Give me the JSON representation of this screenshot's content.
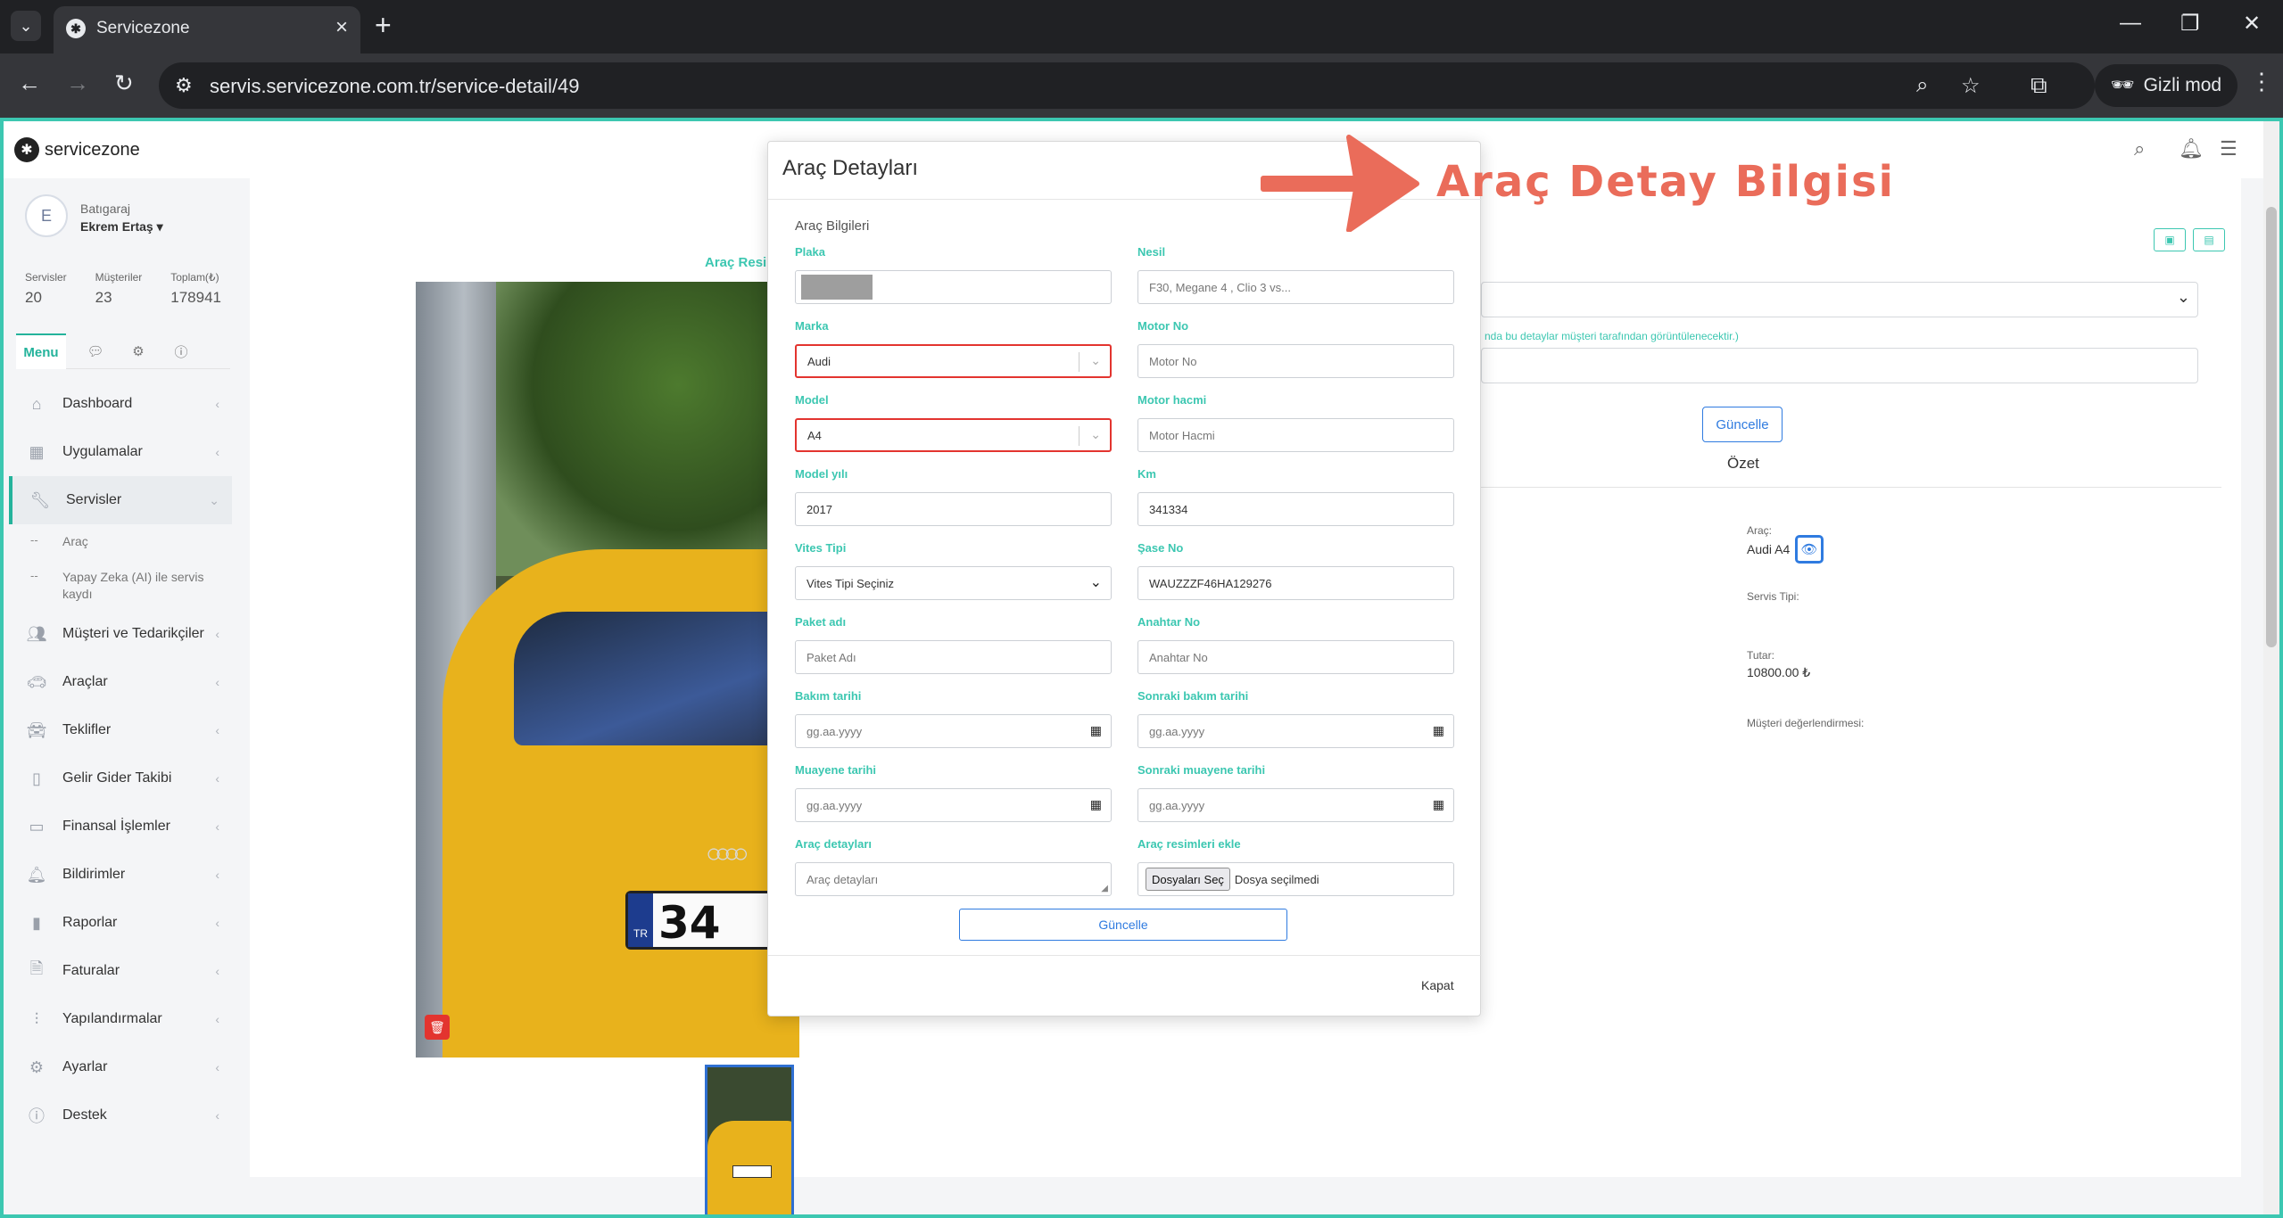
{
  "browser": {
    "tab_title": "Servicezone",
    "url": "servis.servicezone.com.tr/service-detail/49",
    "incognito_label": "Gizli mod"
  },
  "app": {
    "logo_text": "servicezone"
  },
  "user": {
    "avatar_letter": "E",
    "org": "Batıgaraj",
    "name": "Ekrem Ertaş ▾"
  },
  "stats": [
    {
      "label": "Servisler",
      "value": "20"
    },
    {
      "label": "Müşteriler",
      "value": "23"
    },
    {
      "label": "Toplam(₺)",
      "value": "178941"
    }
  ],
  "menu_tabs": {
    "active": "Menu"
  },
  "nav": {
    "dashboard": "Dashboard",
    "uygulamalar": "Uygulamalar",
    "servisler": "Servisler",
    "sub_arac": "Araç",
    "sub_ai": "Yapay Zeka (AI) ile servis kaydı",
    "musteri": "Müşteri ve Tedarikçiler",
    "araclar": "Araçlar",
    "teklifler": "Teklifler",
    "gelir": "Gelir Gider Takibi",
    "finansal": "Finansal İşlemler",
    "bildirimler": "Bildirimler",
    "raporlar": "Raporlar",
    "faturalar": "Faturalar",
    "yapilandirmalar": "Yapılandırmalar",
    "ayarlar": "Ayarlar",
    "destek": "Destek"
  },
  "content": {
    "photo_caption": "Araç Resim",
    "hint_text": "nda bu detaylar müşteri tarafından görüntülenecektir.)",
    "update_button": "Güncelle",
    "summary_title": "Özet",
    "vehicle_label": "Araç:",
    "vehicle_value": "Audi A4",
    "service_type_label": "Servis Tipi:",
    "amount_label": "Tutar:",
    "amount_value": "10800.00 ₺",
    "rating_label": "Müşteri değerlendirmesi:",
    "plate_prefix": "TR",
    "plate_number": "34"
  },
  "modal": {
    "title": "Araç Detayları",
    "section": "Araç Bilgileri",
    "fields": {
      "plaka_label": "Plaka",
      "nesil_label": "Nesil",
      "nesil_placeholder": "F30, Megane 4 , Clio 3 vs...",
      "marka_label": "Marka",
      "marka_value": "Audi",
      "motor_no_label": "Motor No",
      "motor_no_placeholder": "Motor No",
      "model_label": "Model",
      "model_value": "A4",
      "motor_hacmi_label": "Motor hacmi",
      "motor_hacmi_placeholder": "Motor Hacmi",
      "model_yili_label": "Model yılı",
      "model_yili_value": "2017",
      "km_label": "Km",
      "km_value": "341334",
      "vites_label": "Vites Tipi",
      "vites_value": "Vites Tipi Seçiniz",
      "sase_label": "Şase No",
      "sase_value": "WAUZZZF46HA129276",
      "paket_label": "Paket adı",
      "paket_placeholder": "Paket Adı",
      "anahtar_label": "Anahtar No",
      "anahtar_placeholder": "Anahtar No",
      "bakim_label": "Bakım tarihi",
      "bakim_placeholder": "gg.aa.yyyy",
      "sonraki_bakim_label": "Sonraki bakım tarihi",
      "sonraki_bakim_placeholder": "gg.aa.yyyy",
      "muayene_label": "Muayene tarihi",
      "muayene_placeholder": "gg.aa.yyyy",
      "sonraki_muayene_label": "Sonraki muayene tarihi",
      "sonraki_muayene_placeholder": "gg.aa.yyyy",
      "detay_label": "Araç detayları",
      "detay_placeholder": "Araç detayları",
      "resim_label": "Araç resimleri ekle",
      "file_button": "Dosyaları Seç",
      "file_status": "Dosya seçilmedi"
    },
    "submit": "Güncelle",
    "close": "Kapat"
  },
  "annotation": {
    "text": "Araç Detay Bilgisi",
    "color": "#ea6c5a"
  },
  "colors": {
    "accent": "#3cc7b1",
    "primary_blue": "#2f7be0",
    "error_red": "#e3342f"
  }
}
